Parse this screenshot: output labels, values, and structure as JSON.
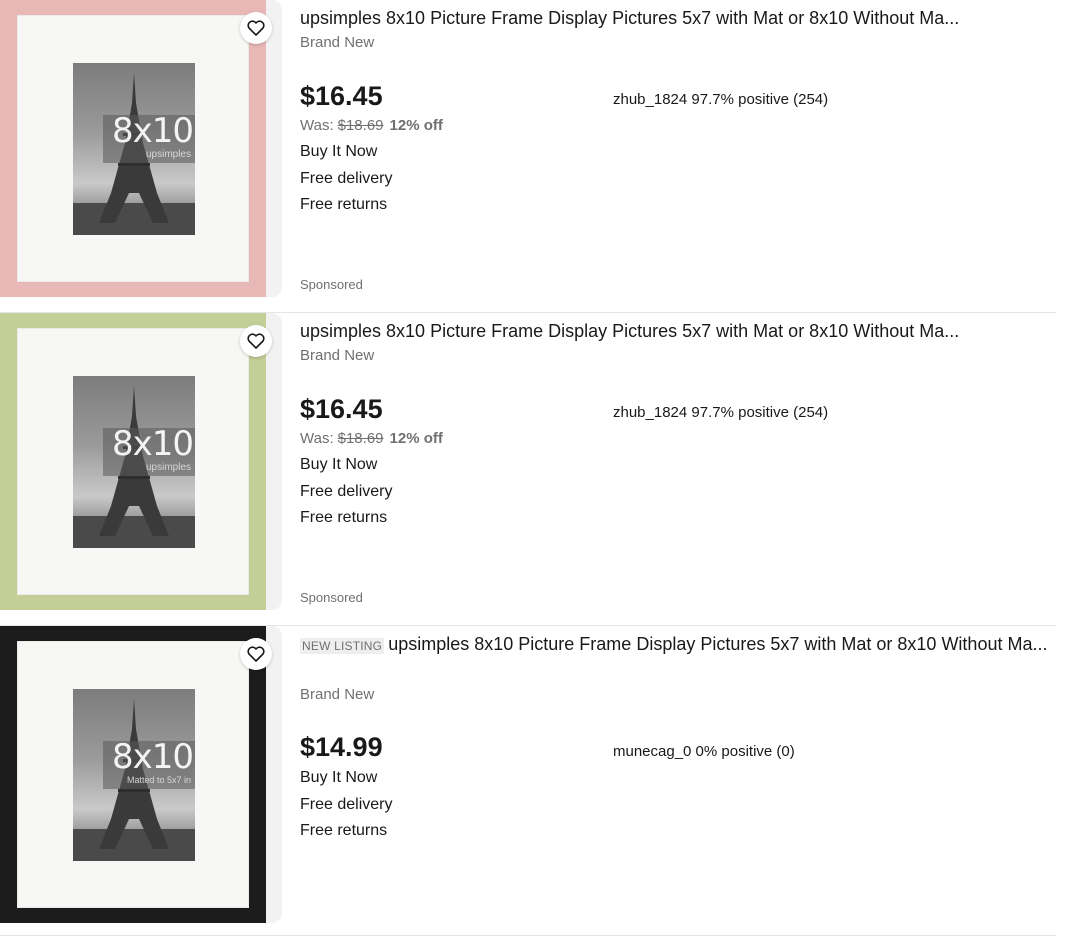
{
  "listings": [
    {
      "new_listing": "",
      "title": "upsimples 8x10 Picture Frame Display Pictures 5x7 with Mat or 8x10 Without Ma...",
      "condition": "Brand New",
      "price": "$16.45",
      "was_label": "Was:",
      "was_price": "$18.69",
      "discount": "12% off",
      "buy_format": "Buy It Now",
      "delivery": "Free delivery",
      "returns": "Free returns",
      "seller": "zhub_1824 97.7% positive (254)",
      "sponsored": "Sponsored",
      "frame_color": "#e8b8b6",
      "image_label": "8x10",
      "image_sublabel": "upsimples",
      "favorite_icon": "heart-icon"
    },
    {
      "new_listing": "",
      "title": "upsimples 8x10 Picture Frame Display Pictures 5x7 with Mat or 8x10 Without Ma...",
      "condition": "Brand New",
      "price": "$16.45",
      "was_label": "Was:",
      "was_price": "$18.69",
      "discount": "12% off",
      "buy_format": "Buy It Now",
      "delivery": "Free delivery",
      "returns": "Free returns",
      "seller": "zhub_1824 97.7% positive (254)",
      "sponsored": "Sponsored",
      "frame_color": "#c3cf97",
      "image_label": "8x10",
      "image_sublabel": "upsimples",
      "favorite_icon": "heart-icon"
    },
    {
      "new_listing": "NEW LISTING",
      "title": "upsimples 8x10 Picture Frame Display Pictures 5x7 with Mat or 8x10 Without Ma...",
      "condition": "Brand New",
      "price": "$14.99",
      "buy_format": "Buy It Now",
      "delivery": "Free delivery",
      "returns": "Free returns",
      "seller": "munecag_0 0% positive (0)",
      "frame_color": "#1c1c1c",
      "image_label": "8x10",
      "image_sublabel": "Matted to 5x7 in",
      "favorite_icon": "heart-icon"
    }
  ]
}
